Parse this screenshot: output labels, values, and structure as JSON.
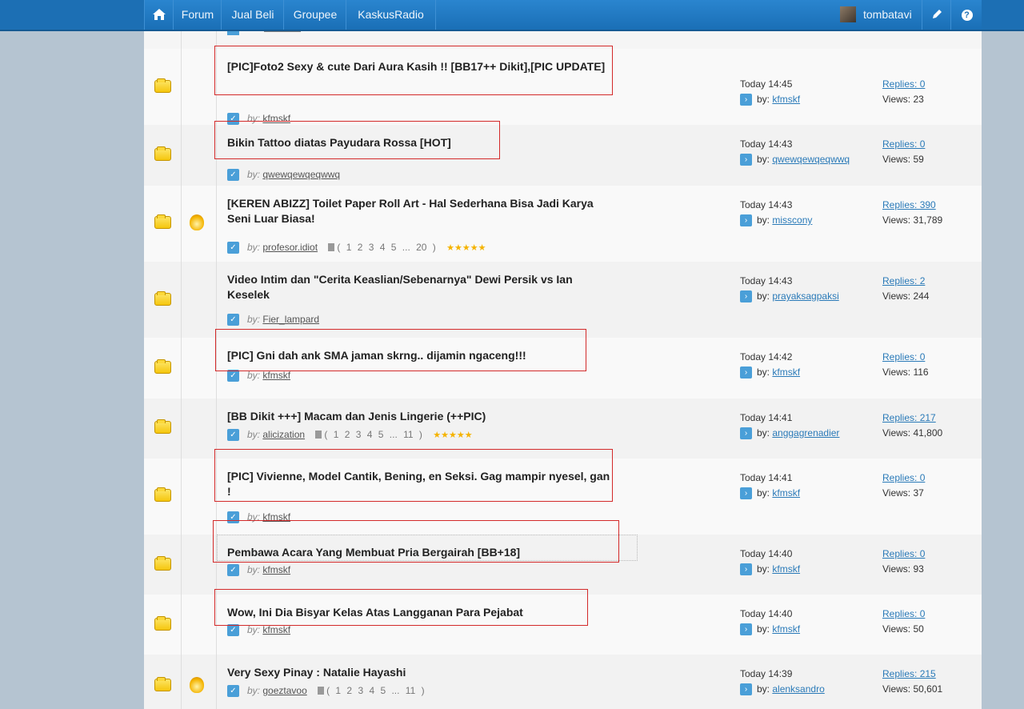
{
  "nav": {
    "forum": "Forum",
    "jual_beli": "Jual Beli",
    "groupee": "Groupee",
    "radio": "KaskusRadio",
    "username": "tombatavi",
    "help": "?"
  },
  "threads": [
    {
      "title": "[PIC]Foto2 Sexy & cute Dari Aura Kasih !! [BB17++ Dikit],[PIC UPDATE]",
      "by_label": "by:",
      "author": "kfmskf",
      "pages": "",
      "rated": false,
      "hot": false,
      "time": "Today 14:45",
      "last_by_label": "by:",
      "last_user": "kfmskf",
      "replies": "Replies: 0",
      "views": "Views: 23"
    },
    {
      "title": "Bikin Tattoo diatas Payudara Rossa [HOT]",
      "by_label": "by:",
      "author": "qwewqewqeqwwq",
      "pages": "",
      "rated": false,
      "hot": false,
      "time": "Today 14:43",
      "last_by_label": "by:",
      "last_user": "qwewqewqeqwwq",
      "replies": "Replies: 0",
      "views": "Views: 59"
    },
    {
      "title": "[KEREN ABIZZ] Toilet Paper Roll Art - Hal Sederhana Bisa Jadi Karya Seni Luar Biasa!",
      "by_label": "by:",
      "author": "profesor.idiot",
      "pages": "( 1 2 3 4 5 ... 20 )",
      "rated": true,
      "hot": true,
      "time": "Today 14:43",
      "last_by_label": "by:",
      "last_user": "misscony",
      "replies": "Replies: 390",
      "views": "Views: 31,789"
    },
    {
      "title": "Video Intim dan \"Cerita Keaslian/Sebenarnya\" Dewi Persik vs Ian Keselek",
      "by_label": "by:",
      "author": "Fier_lampard",
      "pages": "",
      "rated": false,
      "hot": false,
      "time": "Today 14:43",
      "last_by_label": "by:",
      "last_user": "prayaksagpaksi",
      "replies": "Replies: 2",
      "views": "Views: 244"
    },
    {
      "title": "[PIC] Gni dah ank SMA jaman skrng.. dijamin ngaceng!!!",
      "by_label": "by:",
      "author": "kfmskf",
      "pages": "",
      "rated": false,
      "hot": false,
      "time": "Today 14:42",
      "last_by_label": "by:",
      "last_user": "kfmskf",
      "replies": "Replies: 0",
      "views": "Views: 116"
    },
    {
      "title": "[BB Dikit +++] Macam dan Jenis Lingerie (++PIC)",
      "by_label": "by:",
      "author": "alicization",
      "pages": "( 1 2 3 4 5 ... 11 )",
      "rated": true,
      "hot": false,
      "time": "Today 14:41",
      "last_by_label": "by:",
      "last_user": "anggagrenadier",
      "replies": "Replies: 217",
      "views": "Views: 41,800"
    },
    {
      "title": "[PIC] Vivienne, Model Cantik, Bening, en Seksi. Gag mampir nyesel, gan !",
      "by_label": "by:",
      "author": "kfmskf",
      "pages": "",
      "rated": false,
      "hot": false,
      "time": "Today 14:41",
      "last_by_label": "by:",
      "last_user": "kfmskf",
      "replies": "Replies: 0",
      "views": "Views: 37"
    },
    {
      "title": "Pembawa Acara Yang Membuat Pria Bergairah [BB+18]",
      "by_label": "by:",
      "author": "kfmskf",
      "pages": "",
      "rated": false,
      "hot": false,
      "time": "Today 14:40",
      "last_by_label": "by:",
      "last_user": "kfmskf",
      "replies": "Replies: 0",
      "views": "Views: 93"
    },
    {
      "title": "Wow, Ini Dia Bisyar Kelas Atas Langganan Para Pejabat",
      "by_label": "by:",
      "author": "kfmskf",
      "pages": "",
      "rated": false,
      "hot": false,
      "time": "Today 14:40",
      "last_by_label": "by:",
      "last_user": "kfmskf",
      "replies": "Replies: 0",
      "views": "Views: 50"
    },
    {
      "title": "Very Sexy Pinay : Natalie Hayashi",
      "by_label": "by:",
      "author": "goeztavoo",
      "pages": "( 1 2 3 4 5 ... 11 )",
      "rated": false,
      "hot": true,
      "time": "Today 14:39",
      "last_by_label": "by:",
      "last_user": "alenksandro",
      "replies": "Replies: 215",
      "views": "Views: 50,601"
    }
  ],
  "colors": {
    "navbar": "#1c6fb4",
    "link": "#2a7ab8",
    "highlight_box": "#d32a2a",
    "background": "#b5c4d1"
  }
}
